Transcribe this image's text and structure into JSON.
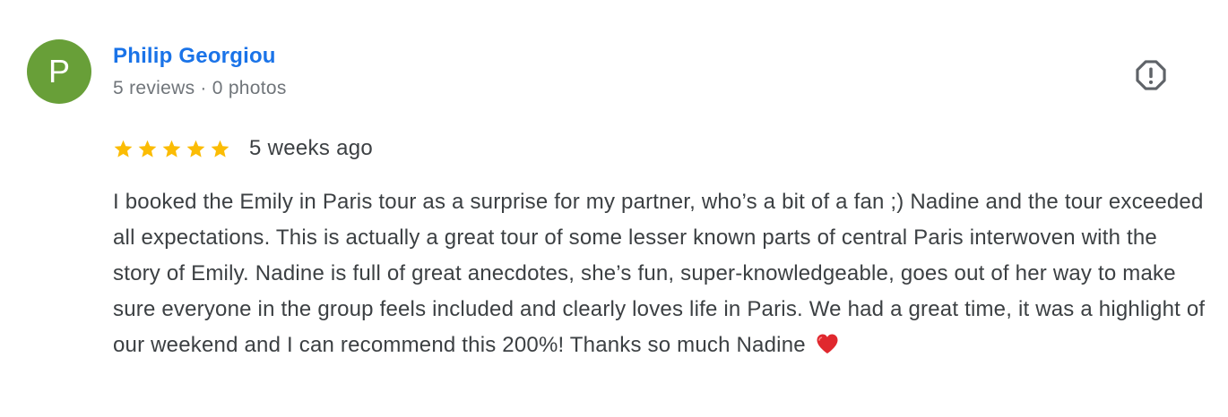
{
  "reviewer": {
    "initial": "P",
    "name": "Philip Georgiou",
    "reviews_count": "5 reviews",
    "separator": "·",
    "photos_count": "0 photos",
    "avatar_color": "#689f38"
  },
  "rating": {
    "stars": 5,
    "max": 5,
    "star_color": "#fbbc04",
    "timestamp": "5 weeks ago"
  },
  "review": {
    "text": "I booked the Emily in Paris tour as a surprise for my partner, who’s a bit of a fan ;) Nadine and the tour exceeded all expectations. This is actually a great tour of some lesser known parts of central Paris interwoven with the story of Emily. Nadine is full of great anecdotes, she’s fun, super-knowledgeable, goes out of her way to make sure everyone in the group feels included and clearly loves life in Paris. We had a great time, it was a highlight of our weekend and I can recommend this 200%! Thanks so much Nadine",
    "emoji_icon": "heart-icon"
  },
  "actions": {
    "flag_icon": "report-icon"
  },
  "colors": {
    "name_link": "#1a73e8",
    "meta_text": "#70757a",
    "body_text": "#3c4043"
  }
}
